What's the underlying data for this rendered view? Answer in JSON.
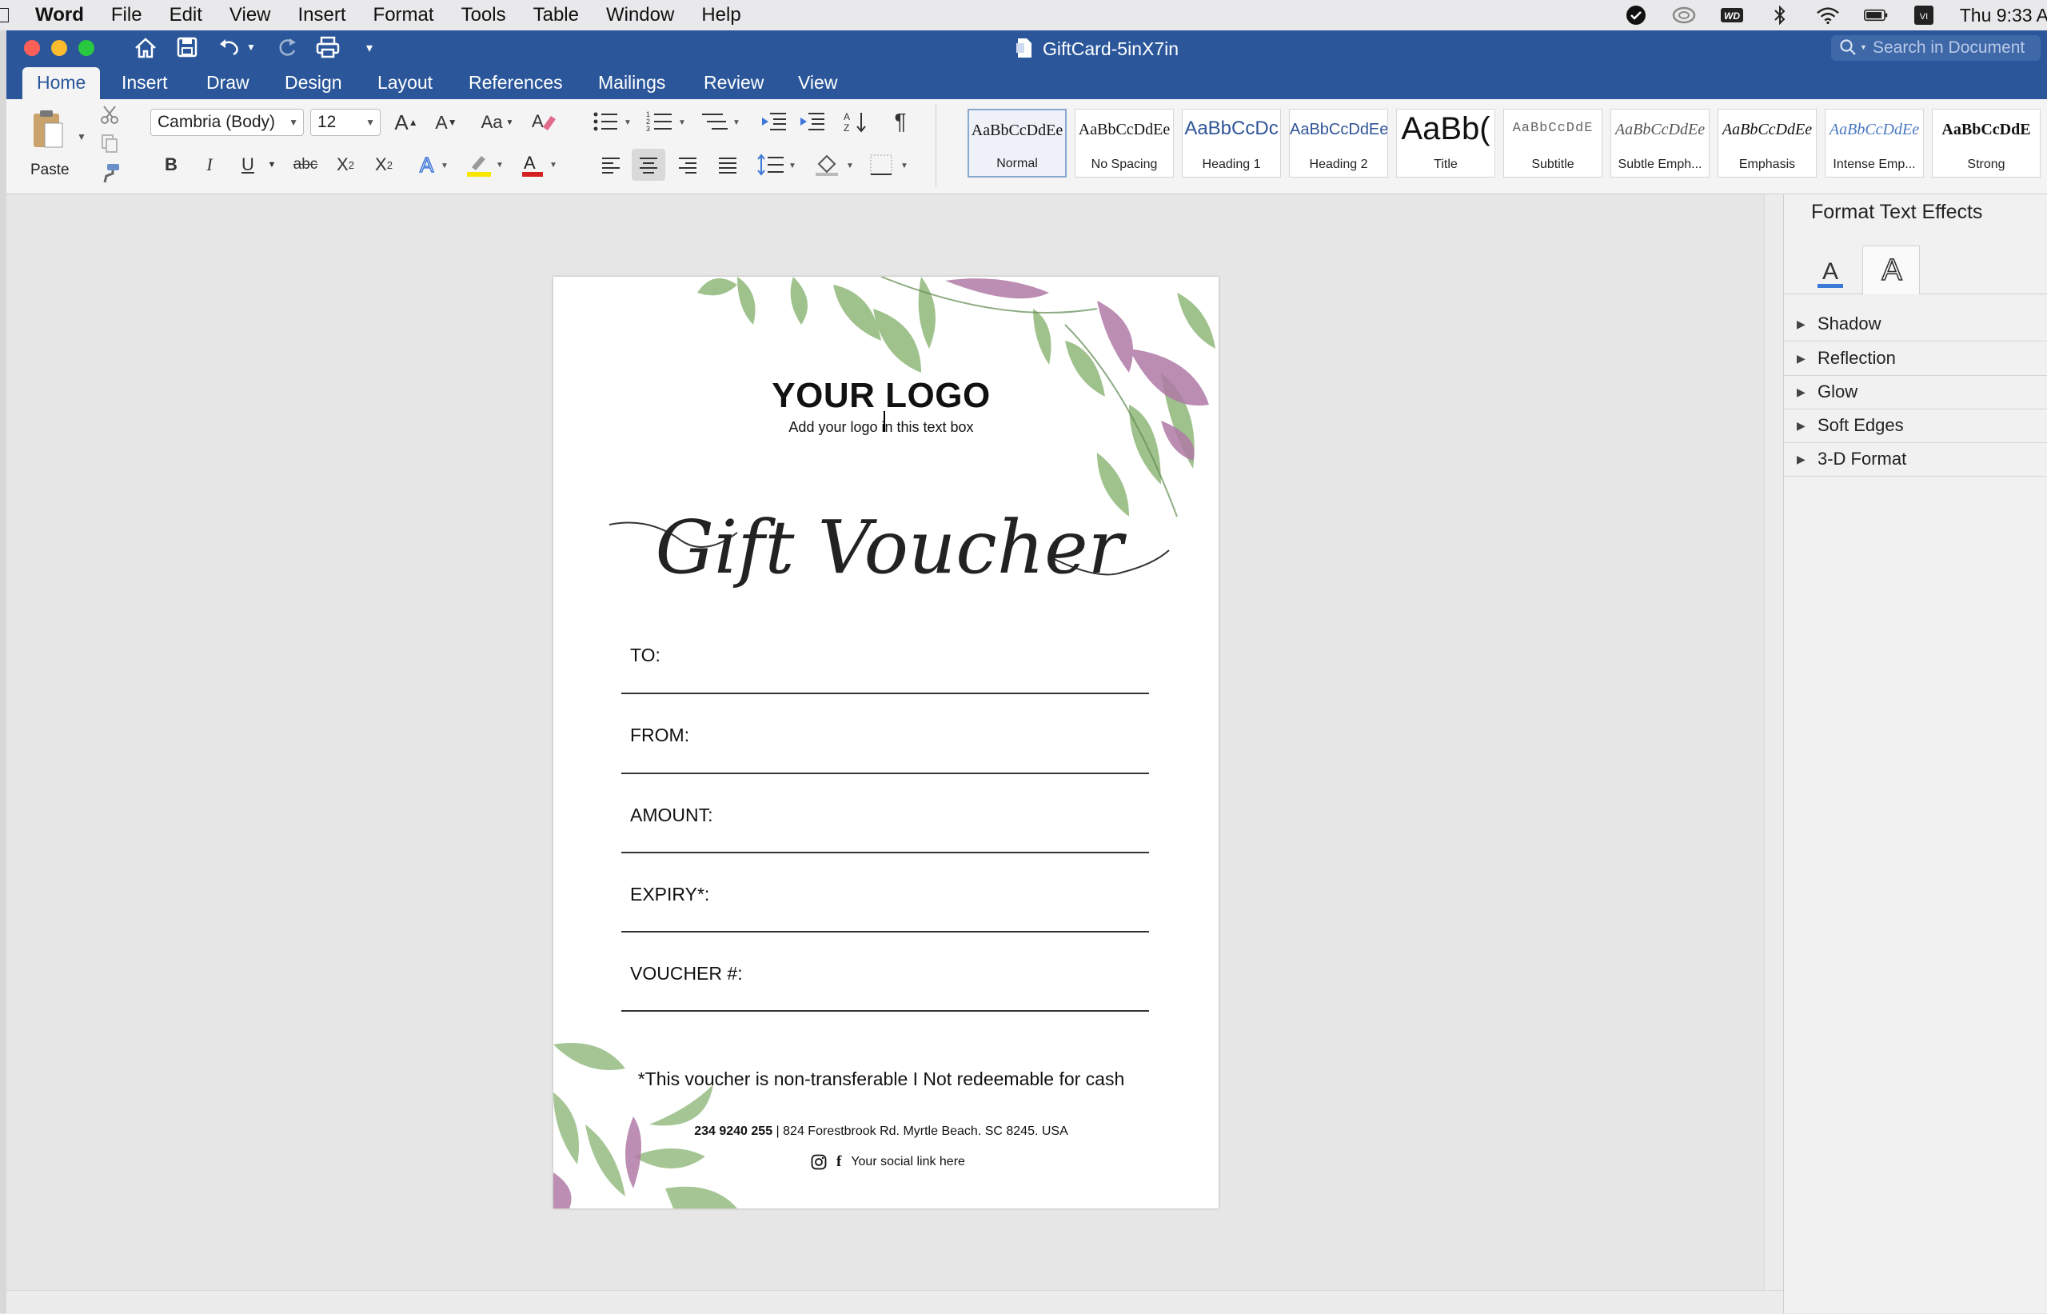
{
  "menubar": {
    "app": "Word",
    "items": [
      "File",
      "Edit",
      "View",
      "Insert",
      "Format",
      "Tools",
      "Table",
      "Window",
      "Help"
    ],
    "clock": "Thu 9:33 A"
  },
  "titlebar": {
    "doc_title": "GiftCard-5inX7in",
    "search_placeholder": "Search in Document"
  },
  "tabs": [
    "Home",
    "Insert",
    "Draw",
    "Design",
    "Layout",
    "References",
    "Mailings",
    "Review",
    "View"
  ],
  "ribbon": {
    "paste_label": "Paste",
    "font_name": "Cambria (Body)",
    "font_size": "12",
    "styles": [
      {
        "preview": "AaBbCcDdEe",
        "name": "Normal"
      },
      {
        "preview": "AaBbCcDdEe",
        "name": "No Spacing"
      },
      {
        "preview": "AaBbCcDc",
        "name": "Heading 1"
      },
      {
        "preview": "AaBbCcDdEe",
        "name": "Heading 2"
      },
      {
        "preview": "AaBb(",
        "name": "Title"
      },
      {
        "preview": "AaBbCcDdE",
        "name": "Subtitle"
      },
      {
        "preview": "AaBbCcDdEe",
        "name": "Subtle Emph..."
      },
      {
        "preview": "AaBbCcDdEe",
        "name": "Emphasis"
      },
      {
        "preview": "AaBbCcDdEe",
        "name": "Intense Emp..."
      },
      {
        "preview": "AaBbCcDdE",
        "name": "Strong"
      }
    ]
  },
  "document": {
    "logo_title": "YOUR LOGO",
    "logo_subtitle": "Add your logo in this text box",
    "heading": "Gift Voucher",
    "fields": [
      "TO:",
      "FROM:",
      "AMOUNT:",
      "EXPIRY*:",
      "VOUCHER #:"
    ],
    "disclaimer": "*This voucher is non-transferable I Not redeemable for cash",
    "phone": "234 9240 255",
    "address": "| 824 Forestbrook Rd. Myrtle Beach. SC 8245. USA",
    "social": "Your social link here"
  },
  "pane": {
    "title": "Format Text Effects",
    "sections": [
      "Shadow",
      "Reflection",
      "Glow",
      "Soft Edges",
      "3-D Format"
    ]
  },
  "colors": {
    "ribbon_blue": "#2b579a",
    "leaf_green": "#7fae6a",
    "leaf_purple": "#b07aa6"
  }
}
